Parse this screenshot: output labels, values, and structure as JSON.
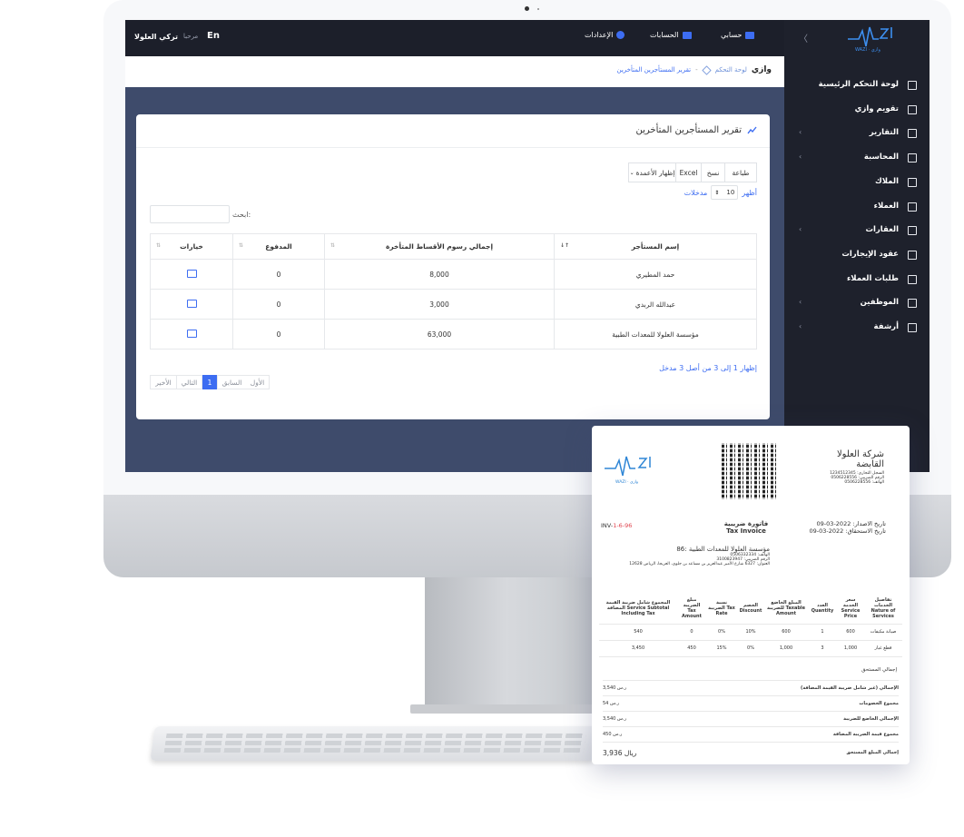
{
  "topbar": {
    "lang": "En",
    "welcome": "مرحبا",
    "user_name": "تركي العلولا",
    "menu": [
      "الإعدادات",
      "الحسابات",
      "حسابي"
    ]
  },
  "sidebar": {
    "logo_text": "WAZI · وازي",
    "items": [
      {
        "label": "لوحة التحكم الرئيسية",
        "icon": "chart-icon",
        "chevron": false
      },
      {
        "label": "تقويم وازي",
        "icon": "calendar-icon",
        "chevron": false
      },
      {
        "label": "التقارير",
        "icon": "document-icon",
        "chevron": true
      },
      {
        "label": "المحاسبة",
        "icon": "card-icon",
        "chevron": true
      },
      {
        "label": "الملاك",
        "icon": "contact-icon",
        "chevron": false
      },
      {
        "label": "العملاء",
        "icon": "users-icon",
        "chevron": false
      },
      {
        "label": "العقارات",
        "icon": "building-icon",
        "chevron": true
      },
      {
        "label": "عقود الإيجارات",
        "icon": "contract-icon",
        "chevron": false
      },
      {
        "label": "طلبات العملاء",
        "icon": "wrench-icon",
        "chevron": false
      },
      {
        "label": "الموظفين",
        "icon": "employee-icon",
        "chevron": true
      },
      {
        "label": "أرشفة",
        "icon": "archive-icon",
        "chevron": true
      }
    ]
  },
  "breadcrumb": {
    "app": "وازي",
    "home": "لوحة التحكم",
    "sep": "-",
    "current": "تقرير المستأجرين المتأخرين"
  },
  "card": {
    "title": "تقرير المستأجرين المتأخرين",
    "buttons": {
      "print": "طباعة",
      "copy": "نسخ",
      "excel": "Excel",
      "columns": "إظهار الأعمدة"
    },
    "show_label": "أظهر",
    "entries_value": "10",
    "entries_label": "مدخلات",
    "search_label": "ابحث:",
    "search_value": "",
    "columns": [
      "إسم المستأجر",
      "إجمالي رسوم الأقساط المتأخرة",
      "المدفوع",
      "خيارات"
    ],
    "rows": [
      {
        "name": "حمد المطيري",
        "total": "8,000",
        "paid": "0"
      },
      {
        "name": "عبدالله الربدي",
        "total": "3,000",
        "paid": "0"
      },
      {
        "name": "مؤسسة العلولا للمعدات الطبية",
        "total": "63,000",
        "paid": "0"
      }
    ],
    "info": "إظهار 1 إلى 3 من أصل 3 مدخل",
    "pagination": {
      "first": "الأول",
      "prev": "السابق",
      "page": "1",
      "next": "التالي",
      "last": "الأخير"
    }
  },
  "invoice": {
    "company_name": "شركة العلولا القابضة",
    "company_lines": [
      "السجل التجاري: 1234512345",
      "الرقم الضريبي: 0506228556",
      "الهاتف: 0506228556"
    ],
    "logo_text": "WAZI · وازي",
    "invoice_no_prefix": "INV-",
    "invoice_no_highlight": "1-6-96",
    "title_ar": "فاتورة ضريبية",
    "title_en": "Tax Invoice",
    "issue_date": "تاريخ الاصدار: 2022-03-09",
    "due_date": "تاريخ الاستحقاق: 2022-03-09",
    "client_name": "مؤسسة العلولا للمعدات الطبية :86",
    "client_lines": [
      "الهاتف: 0506332334",
      "الرقم الضريبي: 3100823947",
      "العنوان: 6327 شارع الأمير عبدالعزيز بن مساعد بن جلوي، العريجا، الرياض 12628"
    ],
    "table_headers": [
      "تفاصيل الخدمات Nature of Services",
      "سعر الخدمة Service Price",
      "العدد Quantity",
      "المبلغ الخاضع للضريبة Taxable Amount",
      "الخصم Discount",
      "نسبة الضريبة Tax Rate",
      "مبلغ الضريبة Tax Amount",
      "المجموع شامل ضريبة القيمة المضافة Service Subtotal Including Tax"
    ],
    "items": [
      {
        "service": "صيانة مكيفات",
        "price": "600",
        "qty": "1",
        "taxable": "600",
        "discount": "10%",
        "rate": "0%",
        "tax": "0",
        "subtotal": "540"
      },
      {
        "service": "قطع غيار",
        "price": "1,000",
        "qty": "3",
        "taxable": "1,000",
        "discount": "0%",
        "rate": "15%",
        "tax": "450",
        "subtotal": "3,450"
      }
    ],
    "total_due_label": "إجمالي المستحق",
    "summary": [
      {
        "label": "الإجمالي (غير شامل ضريبة القيمة المضافة)",
        "value": "3,540 ر.س"
      },
      {
        "label": "مجموع الخصومات",
        "value": "54 ر.س"
      },
      {
        "label": "الإجمالي الخاضع للضريبة",
        "value": "3,540 ر.س"
      },
      {
        "label": "مجموع قيمة الضريبة المضافة",
        "value": "450 ر.س"
      }
    ],
    "final_label": "إجمالي المبلغ المستحق",
    "final_value": "3,936 ريال"
  },
  "colors": {
    "accent": "#3d6df2",
    "sidebar": "#1e212c",
    "content_bg": "#3e4b6b",
    "highlight": "#e0454f"
  }
}
